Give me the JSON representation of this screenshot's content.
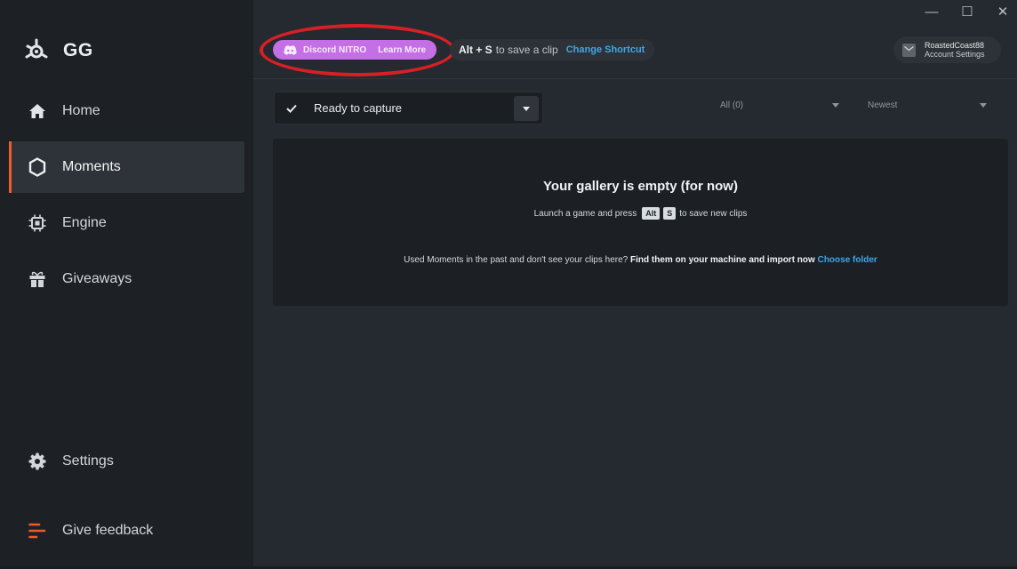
{
  "app": {
    "brand": "GG"
  },
  "window_controls": {
    "minimize": "—",
    "maximize": "☐",
    "close": "✕"
  },
  "sidebar": {
    "items": [
      {
        "label": "Home",
        "icon": "home-icon"
      },
      {
        "label": "Moments",
        "icon": "hexagon-icon",
        "active": true
      },
      {
        "label": "Engine",
        "icon": "chip-icon"
      },
      {
        "label": "Giveaways",
        "icon": "gift-icon"
      }
    ],
    "settings_label": "Settings",
    "feedback_label": "Give feedback"
  },
  "topbar": {
    "nitro_label": "Discord NITRO",
    "learn_more_label": "Learn More",
    "shortcut_keys": "Alt + S",
    "shortcut_desc": "to save a clip",
    "change_shortcut_label": "Change Shortcut",
    "account_name": "RoastedCoast88",
    "account_settings_label": "Account Settings"
  },
  "filters": {
    "capture_status": "Ready to capture",
    "type_filter": "All (0)",
    "sort": "Newest"
  },
  "gallery": {
    "empty_title": "Your gallery is empty (for now)",
    "hint_prefix": "Launch a game and press",
    "key1": "Alt",
    "key2": "S",
    "hint_suffix": "to save new clips",
    "import_text": "Used Moments in the past and don't see your clips here?",
    "import_bold": "Find them on your machine and import now",
    "import_link": "Choose folder"
  },
  "colors": {
    "accent": "#f05a28",
    "nitro": "#c46fe6",
    "link": "#3fa6e8",
    "highlight_circle": "#d81f26"
  }
}
